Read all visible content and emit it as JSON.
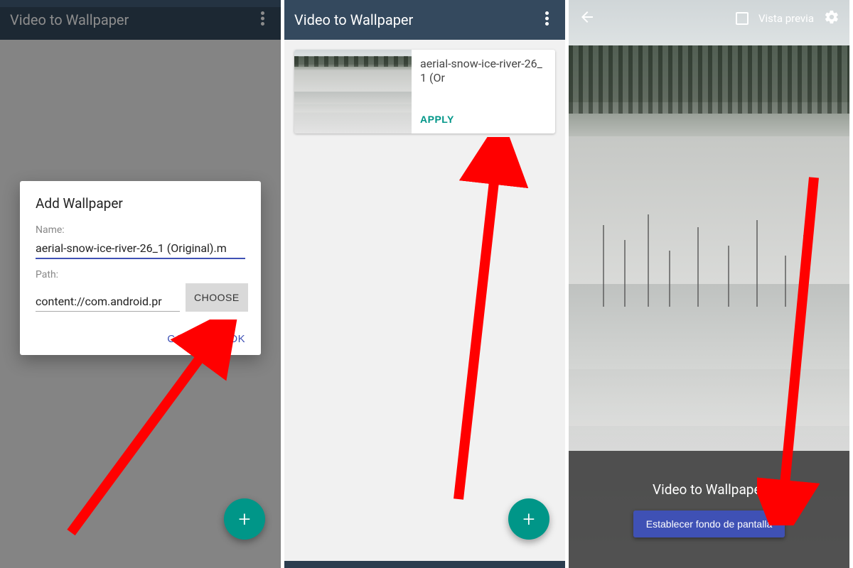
{
  "colors": {
    "appbar": "#34495e",
    "accent_teal": "#009688",
    "accent_indigo": "#3f51b5",
    "arrow": "#ff0000"
  },
  "appbar": {
    "title": "Video to Wallpaper"
  },
  "panel1": {
    "dialog": {
      "title": "Add Wallpaper",
      "name_label": "Name:",
      "name_value": "aerial-snow-ice-river-26_1 (Original).m",
      "path_label": "Path:",
      "path_value": "content://com.android.pr",
      "choose_label": "CHOOSE",
      "cancel_label": "CANCEL",
      "ok_label": "OK"
    },
    "fab_label": "+"
  },
  "panel2": {
    "card": {
      "title": "aerial-snow-ice-river-26_1 (Or",
      "apply_label": "APPLY"
    },
    "fab_label": "+"
  },
  "panel3": {
    "preview_label": "Vista previa",
    "sheet_title": "Video to Wallpaper",
    "set_button": "Establecer fondo de pantalla"
  }
}
